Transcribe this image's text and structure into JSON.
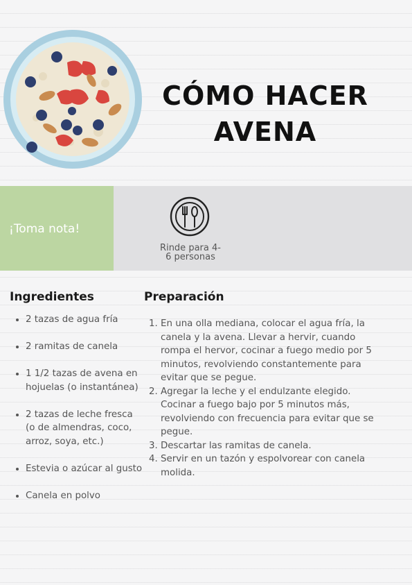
{
  "header": {
    "title_line1": "CÓMO HACER",
    "title_line2": "AVENA"
  },
  "band": {
    "note": "¡Toma nota!",
    "icon": "fork-knife-plate-icon",
    "servings_line1": "Rinde para 4-",
    "servings_line2": "6 personas"
  },
  "ingredients": {
    "heading": "Ingredientes",
    "items": [
      "2 tazas de agua fría",
      "2 ramitas de canela",
      "1 1/2 tazas de avena en hojuelas (o instantánea)",
      "2 tazas de leche fresca (o de almendras, coco, arroz, soya, etc.)",
      "Estevia o azúcar al gusto",
      "Canela en polvo"
    ]
  },
  "preparation": {
    "heading": "Preparación",
    "steps": [
      "En una olla mediana, colocar el agua fría, la canela y la avena. Llevar a hervir, cuando rompa el hervor, cocinar a fuego medio por 5 minutos, revolviendo constantemente para evitar que se pegue.",
      "Agregar la leche y el endulzante elegido. Cocinar a fuego bajo por 5 minutos más, revolviendo con frecuencia para evitar que se pegue.",
      "Descartar las ramitas de canela.",
      "Servir en un tazón y espolvorear con canela molida."
    ]
  },
  "colors": {
    "green_band": "#bcd6a2",
    "grey_band": "#e0e0e2",
    "bowl": "#a9cfe0"
  }
}
